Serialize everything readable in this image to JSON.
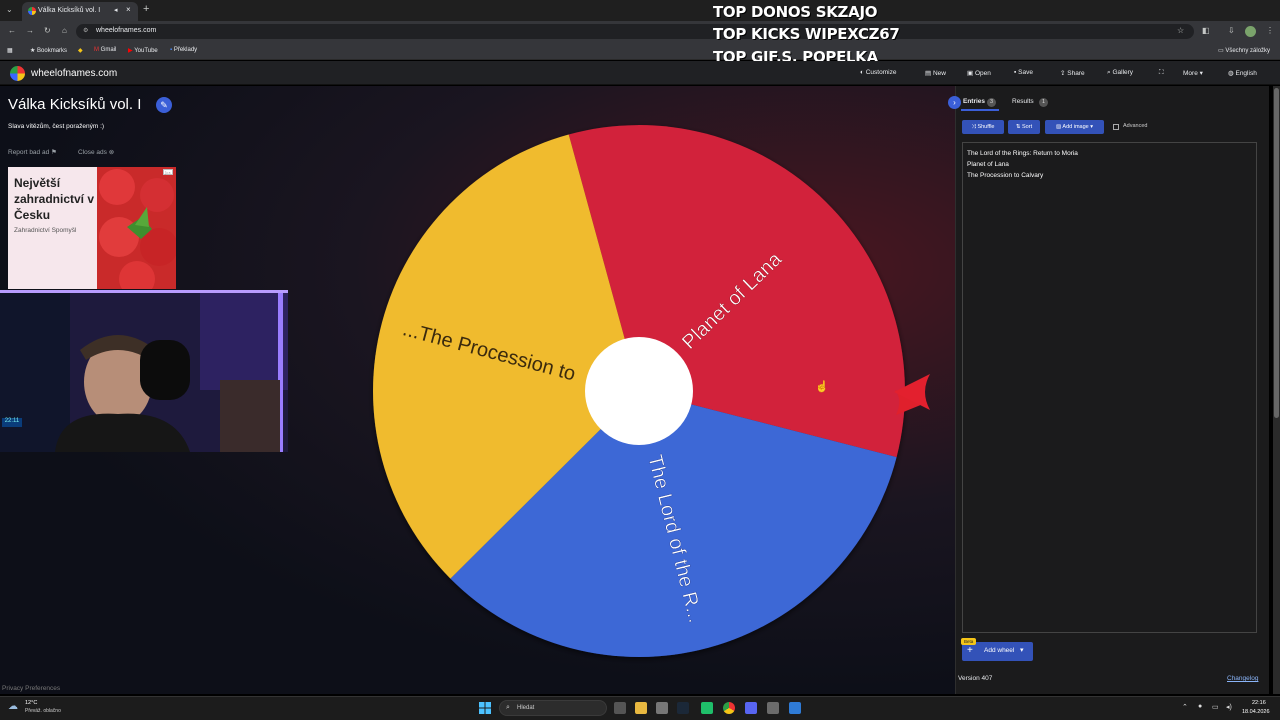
{
  "browser": {
    "tab_title": "Válka Kicksíků vol. I",
    "url": "wheelofnames.com",
    "bookmarks": [
      "Bookmarks",
      "Gmail",
      "YouTube",
      "Překlady"
    ],
    "other_bookmarks": "Všechny záložky"
  },
  "overlay": {
    "line1": "TOP DONOS SKZAJO",
    "line2": "TOP KICKS WIPEXCZ67",
    "line3": "TOP GIF.S.  POPELKA"
  },
  "header": {
    "logo_text": "wheelofnames.com",
    "nav": [
      "Customize",
      "New",
      "Open",
      "Save",
      "Share",
      "Gallery",
      "More",
      "English"
    ]
  },
  "wheel": {
    "title": "Válka Kicksíků vol. I",
    "description": "Slava vítězům, čest poraženým :)",
    "report_ad": "Report bad ad",
    "close_ads": "Close ads",
    "slices": [
      {
        "label": "Planet of Lana",
        "color": "#d2223a"
      },
      {
        "label": "The Lord of the R...",
        "color": "#3e67d6"
      },
      {
        "label": "The Procession to...",
        "color": "#f0bb2e"
      }
    ]
  },
  "ad": {
    "title": "Největší zahradnictví v Česku",
    "subtitle": "Zahradnictví Spomyšl"
  },
  "webcam": {
    "clock": "22:11"
  },
  "privacy": "Privacy Preferences",
  "sidebar": {
    "entries_tab": "Entries",
    "entries_count": "3",
    "results_tab": "Results",
    "results_count": "1",
    "shuffle": "Shuffle",
    "sort": "Sort",
    "add_image": "Add image",
    "advanced": "Advanced",
    "entries": [
      "The Lord of the Rings: Return to Moria",
      "Planet of Lana",
      "The Procession to Calvary"
    ],
    "beta": "Beta",
    "add_wheel": "Add wheel",
    "version": "Version 407",
    "changelog": "Changelog"
  },
  "taskbar": {
    "temp": "12°C",
    "weather": "Převáž. oblačno",
    "search": "Hledat",
    "time": "22:16",
    "date": "18.04.2026"
  }
}
